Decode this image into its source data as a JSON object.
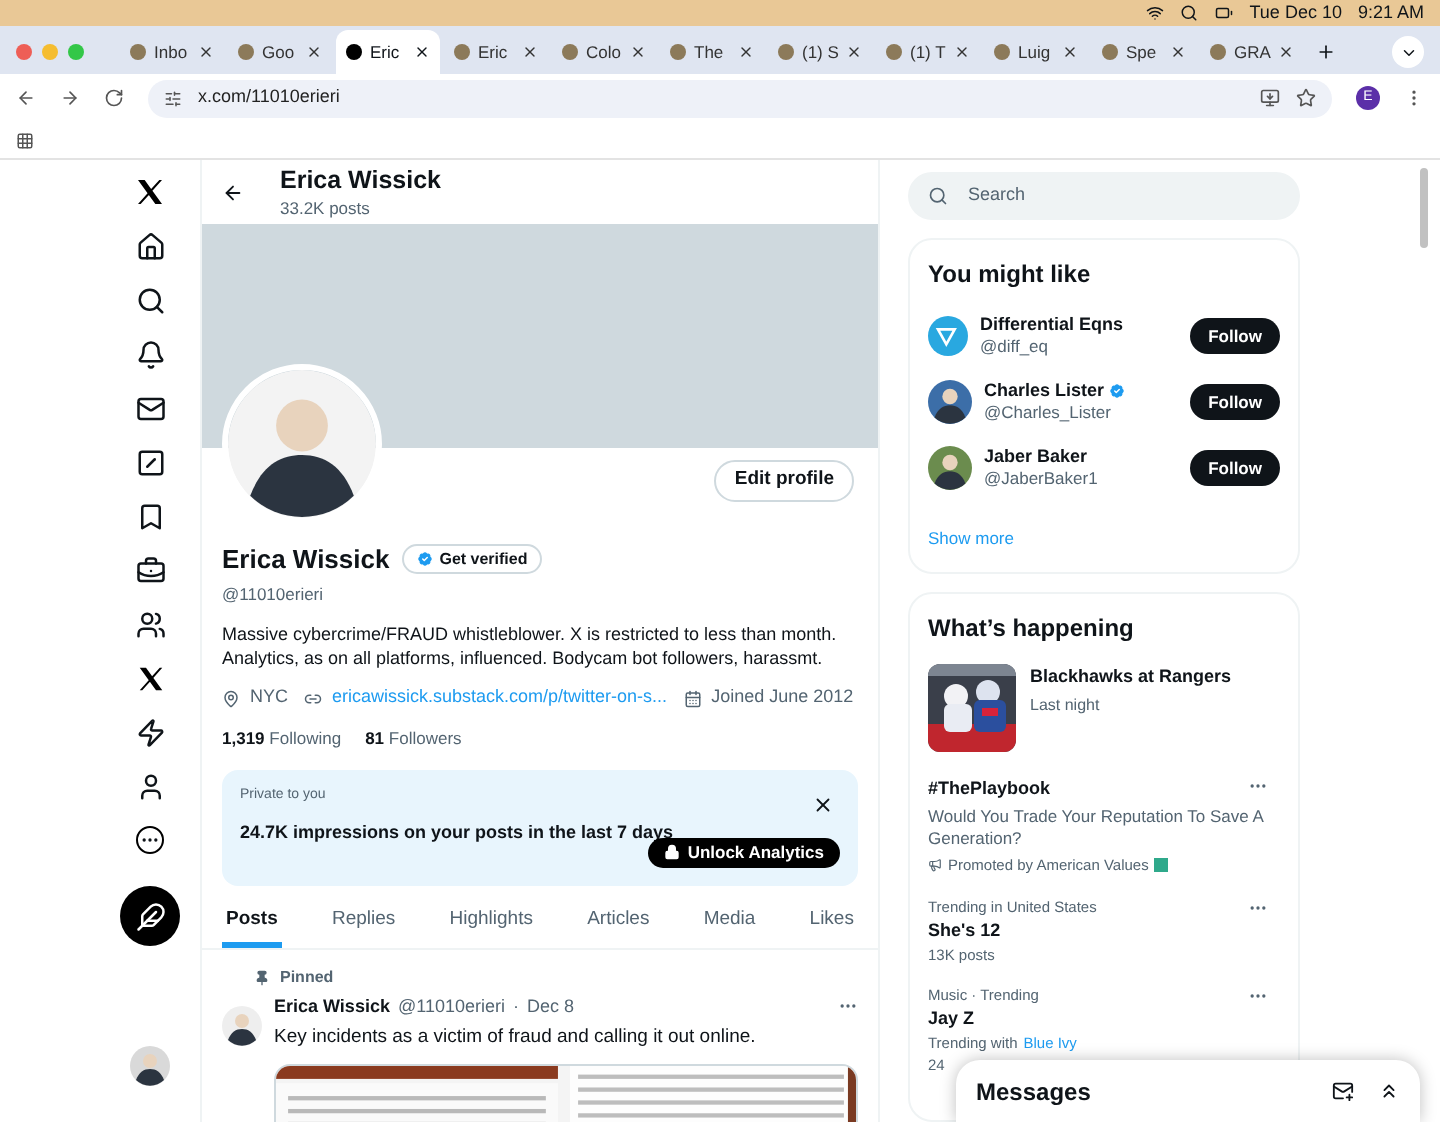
{
  "menu_bar": {
    "date": "Tue Dec 10",
    "time": "9:21 AM"
  },
  "browser": {
    "tabs": [
      {
        "title": "Inbo",
        "selected": false
      },
      {
        "title": "Goo",
        "selected": false
      },
      {
        "title": "Eric",
        "selected": true
      },
      {
        "title": "Eric",
        "selected": false
      },
      {
        "title": "Colo",
        "selected": false
      },
      {
        "title": "The",
        "selected": false
      },
      {
        "title": "(1) S",
        "selected": false
      },
      {
        "title": "(1) T",
        "selected": false
      },
      {
        "title": "Luig",
        "selected": false
      },
      {
        "title": "Spe",
        "selected": false
      },
      {
        "title": "GRA",
        "selected": false
      }
    ],
    "address": "x.com/11010erieri",
    "profile_initial": "E"
  },
  "header": {
    "name": "Erica Wissick",
    "posts": "33.2K posts"
  },
  "profile": {
    "edit_button": "Edit profile",
    "name": "Erica Wissick",
    "get_verified": "Get verified",
    "handle": "@11010erieri",
    "bio": "Massive cybercrime/FRAUD whistleblower. X is restricted to less than month. Analytics, as on all platforms, influenced. Bodycam bot followers, harassmt.",
    "location": "NYC",
    "link": "ericawissick.substack.com/p/twitter-on-s...",
    "joined": "Joined June 2012",
    "following_count": "1,319",
    "following_label": "Following",
    "followers_count": "81",
    "followers_label": "Followers"
  },
  "analytics": {
    "label": "Private to you",
    "text": "24.7K impressions on your posts in the last 7 days",
    "button": "Unlock Analytics"
  },
  "tabs": [
    {
      "label": "Posts",
      "selected": true
    },
    {
      "label": "Replies",
      "selected": false
    },
    {
      "label": "Highlights",
      "selected": false
    },
    {
      "label": "Articles",
      "selected": false
    },
    {
      "label": "Media",
      "selected": false
    },
    {
      "label": "Likes",
      "selected": false
    }
  ],
  "pinned_post": {
    "pinned_label": "Pinned",
    "name": "Erica Wissick",
    "handle": "@11010erieri",
    "separator": "·",
    "date": "Dec 8",
    "text": "Key incidents as a victim of fraud and calling it out online."
  },
  "search": {
    "placeholder": "Search"
  },
  "you_might_like": {
    "title": "You might like",
    "accounts": [
      {
        "name": "Differential Eqns",
        "handle": "@diff_eq",
        "verified": false,
        "kind": "logo",
        "button": "Follow"
      },
      {
        "name": "Charles Lister",
        "handle": "@Charles_Lister",
        "verified": true,
        "kind": "person",
        "button": "Follow"
      },
      {
        "name": "Jaber Baker",
        "handle": "@JaberBaker1",
        "verified": false,
        "kind": "person",
        "button": "Follow"
      }
    ],
    "show_more": "Show more"
  },
  "whats_happening": {
    "title": "What’s happening",
    "trends": [
      {
        "kind": "event",
        "title": "Blackhawks at Rangers",
        "subtitle": "Last night"
      },
      {
        "kind": "promoted",
        "title": "#ThePlaybook",
        "text": "Would You Trade Your Reputation To Save A Generation?",
        "promoter": "Promoted by American Values"
      },
      {
        "kind": "trend",
        "context": "Trending in United States",
        "title": "She's 12",
        "stats": "13K posts"
      },
      {
        "kind": "trend_with",
        "context": "Music · Trending",
        "title": "Jay Z",
        "with_label": "Trending with",
        "with_link": "Blue Ivy",
        "stats": "24"
      }
    ]
  },
  "messages": {
    "title": "Messages"
  }
}
